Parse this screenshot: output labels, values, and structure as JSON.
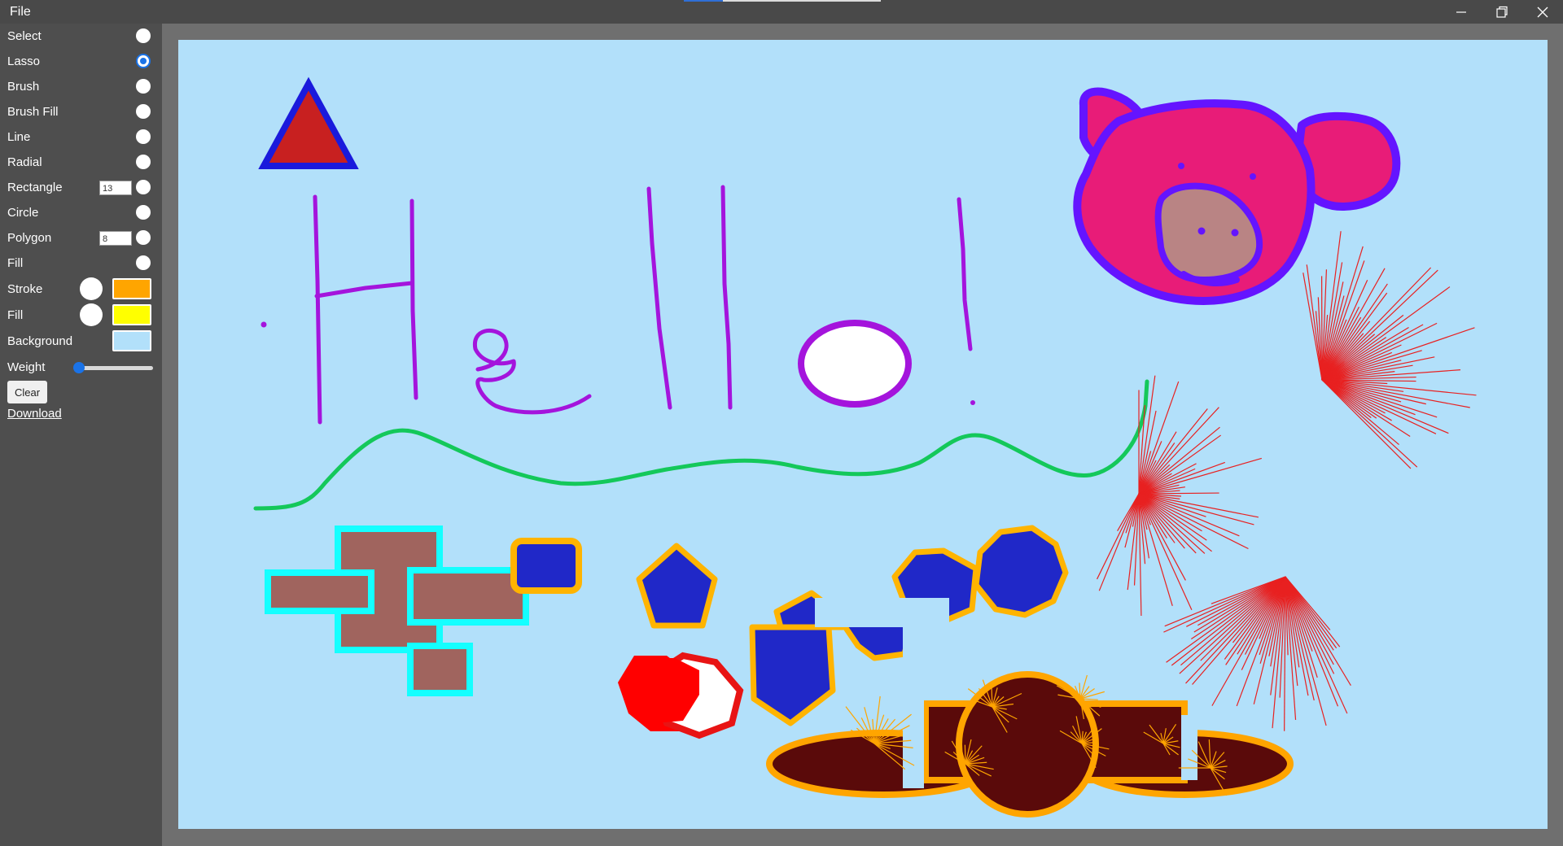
{
  "menu": {
    "file": "File"
  },
  "tools": {
    "select": "Select",
    "lasso": "Lasso",
    "brush": "Brush",
    "brush_fill": "Brush Fill",
    "line": "Line",
    "radial": "Radial",
    "rectangle": "Rectangle",
    "rectangle_value": "13",
    "circle": "Circle",
    "polygon": "Polygon",
    "polygon_value": "8",
    "fill": "Fill",
    "selected": "Lasso"
  },
  "colors": {
    "stroke_label": "Stroke",
    "stroke": "#ffa500",
    "fill_label": "Fill",
    "fill": "#ffff00",
    "background_label": "Background",
    "background": "#b2e0fa"
  },
  "weight": {
    "label": "Weight",
    "value": 0.04
  },
  "actions": {
    "clear": "Clear",
    "download": "Download"
  },
  "icons": {
    "minimize": "minimize-icon",
    "restore": "restore-icon",
    "close": "close-icon"
  }
}
